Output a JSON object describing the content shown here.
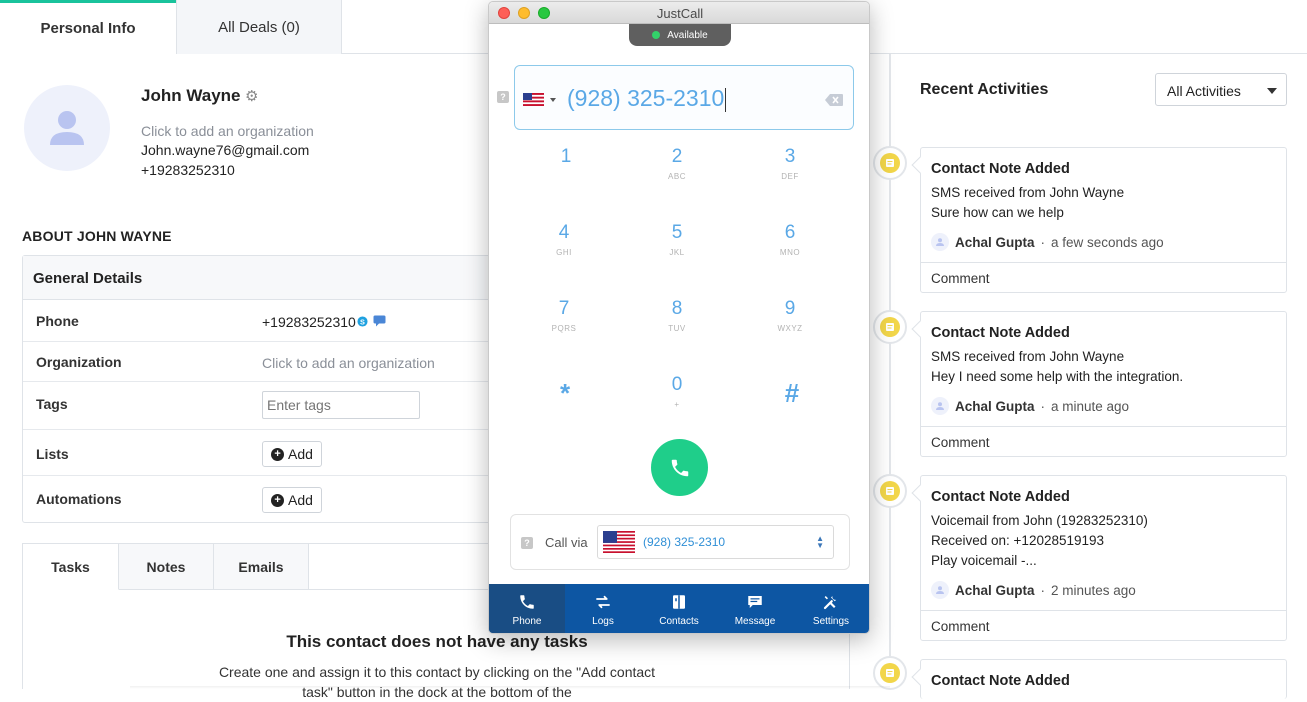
{
  "tabs": {
    "personal": "Personal Info",
    "deals": "All Deals (0)"
  },
  "profile": {
    "name": "John Wayne",
    "org_hint": "Click to add an organization",
    "email": "John.wayne76@gmail.com",
    "phone": "+19283252310"
  },
  "about_title": "ABOUT JOHN WAYNE",
  "general": {
    "title": "General Details",
    "phone_label": "Phone",
    "phone_value": "+19283252310",
    "org_label": "Organization",
    "org_value": "Click to add an organization",
    "tags_label": "Tags",
    "tags_placeholder": "Enter tags",
    "lists_label": "Lists",
    "automations_label": "Automations",
    "add_label": "Add"
  },
  "subtabs": {
    "tasks": "Tasks",
    "notes": "Notes",
    "emails": "Emails"
  },
  "tasks": {
    "empty_title": "This contact does not have any tasks",
    "empty_sub": "Create one and assign it to this contact by clicking on the \"Add contact task\" button in the dock at the bottom of the"
  },
  "activities": {
    "title": "Recent Activities",
    "filter": "All Activities",
    "comment_label": "Comment",
    "items": [
      {
        "title": "Contact Note Added",
        "lines": [
          "SMS received from John Wayne",
          "Sure how can we help"
        ],
        "author": "Achal Gupta",
        "time": "a few seconds ago"
      },
      {
        "title": "Contact Note Added",
        "lines": [
          "SMS received from John Wayne",
          "Hey I need some help with the integration."
        ],
        "author": "Achal Gupta",
        "time": "a minute ago"
      },
      {
        "title": "Contact Note Added",
        "lines": [
          "Voicemail from John (19283252310)",
          "Received on: +12028519193",
          "Play voicemail -..."
        ],
        "author": "Achal Gupta",
        "time": "2 minutes ago"
      },
      {
        "title": "Contact Note Added"
      }
    ]
  },
  "justcall": {
    "title": "JustCall",
    "status": "Available",
    "number": "(928) 325-2310",
    "keys": [
      {
        "d": "1",
        "l": ""
      },
      {
        "d": "2",
        "l": "ABC"
      },
      {
        "d": "3",
        "l": "DEF"
      },
      {
        "d": "4",
        "l": "GHI"
      },
      {
        "d": "5",
        "l": "JKL"
      },
      {
        "d": "6",
        "l": "MNO"
      },
      {
        "d": "7",
        "l": "PQRS"
      },
      {
        "d": "8",
        "l": "TUV"
      },
      {
        "d": "9",
        "l": "WXYZ"
      },
      {
        "d": "*",
        "l": ""
      },
      {
        "d": "0",
        "l": "+"
      },
      {
        "d": "#",
        "l": ""
      }
    ],
    "call_via_label": "Call via",
    "call_via_number": "(928) 325-2310",
    "nav": [
      "Phone",
      "Logs",
      "Contacts",
      "Message",
      "Settings"
    ]
  },
  "colors": {
    "accent": "#19c39c",
    "dialer_blue": "#5aa8e6",
    "nav_blue": "#0d56a3",
    "call_green": "#1fce8a",
    "note_yellow": "#f2d64a"
  }
}
